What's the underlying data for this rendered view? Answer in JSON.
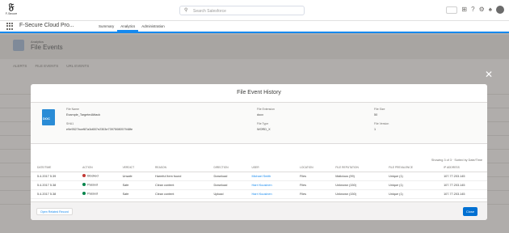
{
  "header": {
    "logo_text": "F-Secure",
    "search_placeholder": "Search Salesforce",
    "icons": [
      "favorites-icon",
      "add-icon",
      "help-icon",
      "setup-icon",
      "notifications-icon",
      "avatar"
    ]
  },
  "nav": {
    "app_name": "F-Secure Cloud Pro...",
    "tabs": [
      {
        "label": "Summary",
        "active": false
      },
      {
        "label": "Analytics",
        "active": true
      },
      {
        "label": "Administration",
        "active": false
      }
    ]
  },
  "page": {
    "subtitle": "Analytics",
    "title": "File Events",
    "subtabs": [
      "ALERTS",
      "FILE EVENTS",
      "URL EVENTS"
    ]
  },
  "modal": {
    "title": "File Event History",
    "file": {
      "icon_label": "DOC",
      "name_label": "File Name",
      "name": "Example_TargetedAttack",
      "sha_label": "SHA1",
      "sha": "e9e9527bcef87a3d657e2303e7397508057948fe",
      "ext_label": "File Extension",
      "ext": "docx",
      "type_label": "File Type",
      "type": "WORD_X",
      "size_label": "File Size",
      "size": "50",
      "version_label": "File Version",
      "version": "1"
    },
    "showing": "Showing 3 of 3 · Sorted by Date/Time",
    "columns": [
      "DATE/TIME",
      "ACTION",
      "VERDICT",
      "REASON",
      "DIRECTION",
      "USER",
      "LOCATION",
      "FILE REPUTATION",
      "FILE PREVALENCE",
      "IP ADDRESS"
    ],
    "rows": [
      {
        "date": "5.4.2017 5.39",
        "action": "Blocked",
        "action_color": "#c23934",
        "verdict": "Unsafe",
        "reason": "Harmful Item found",
        "direction": "Download",
        "user": "Michael Smith",
        "location": "Files",
        "reputation": "Malicious (99)",
        "prevalence": "Unique (1)",
        "ip": "107.77.203.145"
      },
      {
        "date": "5.4.2017 5.38",
        "action": "Passed",
        "action_color": "#04844b",
        "verdict": "Safe",
        "reason": "Clean content",
        "direction": "Download",
        "user": "Harri Kuusinen",
        "location": "Files",
        "reputation": "Unknown (150)",
        "prevalence": "Unique (1)",
        "ip": "107.77.203.145"
      },
      {
        "date": "5.4.2017 5.38",
        "action": "Passed",
        "action_color": "#04844b",
        "verdict": "Safe",
        "reason": "Clean content",
        "direction": "Upload",
        "user": "Harri Kuusinen",
        "location": "Files",
        "reputation": "Unknown (150)",
        "prevalence": "Unique (1)",
        "ip": "107.77.203.145"
      }
    ],
    "open_button": "Open Related Record",
    "close_button": "Close"
  }
}
